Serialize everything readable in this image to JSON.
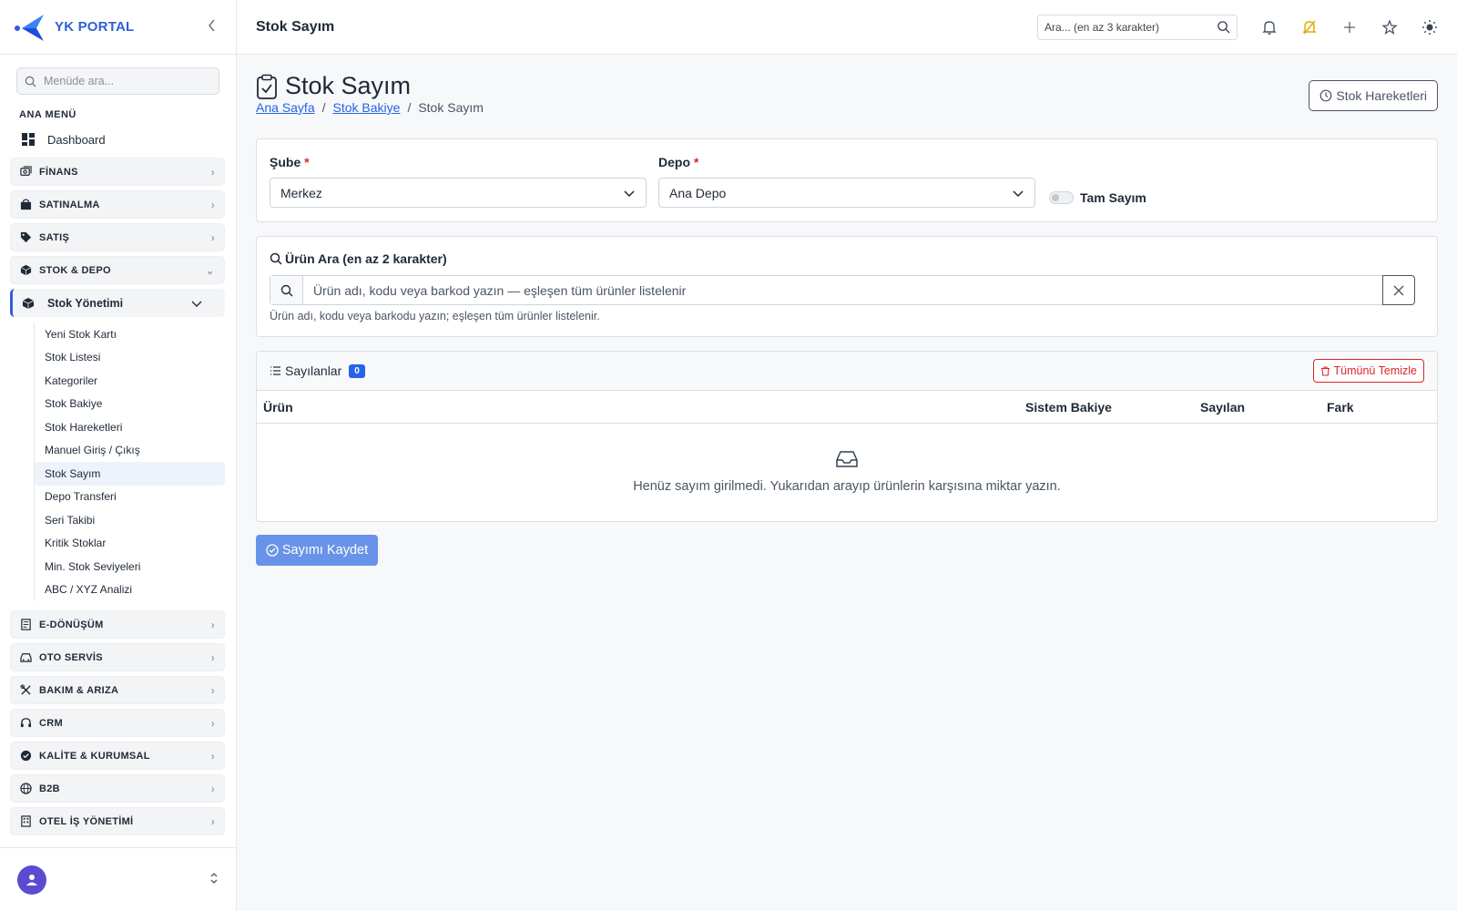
{
  "brand": {
    "name": "YK PORTAL"
  },
  "sidebar": {
    "search_placeholder": "Menüde ara...",
    "section_title": "ANA MENÜ",
    "dashboard_label": "Dashboard",
    "groups_top": [
      {
        "label": "FİNANS",
        "icon": "finance-icon"
      },
      {
        "label": "SATINALMA",
        "icon": "shopping-bag-icon"
      },
      {
        "label": "SATIŞ",
        "icon": "tag-icon"
      }
    ],
    "stock_group": {
      "label": "STOK & DEPO",
      "icon": "box-icon"
    },
    "stock_sub_head": "Stok Yönetimi",
    "stock_items": [
      "Yeni Stok Kartı",
      "Stok Listesi",
      "Kategoriler",
      "Stok Bakiye",
      "Stok Hareketleri",
      "Manuel Giriş / Çıkış",
      "Stok Sayım",
      "Depo Transferi",
      "Seri Takibi",
      "Kritik Stoklar",
      "Min. Stok Seviyeleri",
      "ABC / XYZ Analizi"
    ],
    "active_item": "Stok Sayım",
    "groups_bottom": [
      {
        "label": "E-DÖNÜŞÜM",
        "icon": "document-icon"
      },
      {
        "label": "OTO SERVİS",
        "icon": "car-icon"
      },
      {
        "label": "BAKIM & ARIZA",
        "icon": "tools-icon"
      },
      {
        "label": "CRM",
        "icon": "headset-icon"
      },
      {
        "label": "KALİTE & KURUMSAL",
        "icon": "quality-badge-icon"
      },
      {
        "label": "B2B",
        "icon": "globe-icon"
      },
      {
        "label": "OTEL İŞ YÖNETİMİ",
        "icon": "building-icon"
      }
    ]
  },
  "topbar": {
    "title": "Stok Sayım",
    "search_placeholder": "Ara... (en az 3 karakter)"
  },
  "page": {
    "title": "Stok Sayım",
    "breadcrumb": [
      "Ana Sayfa",
      "Stok Bakiye",
      "Stok Sayım"
    ],
    "history_button": "Stok Hareketleri"
  },
  "filters": {
    "branch_label": "Şube",
    "branch_value": "Merkez",
    "warehouse_label": "Depo",
    "warehouse_value": "Ana Depo",
    "required_mark": "*",
    "full_count_label": "Tam Sayım",
    "full_count_on": false
  },
  "product_search": {
    "label": "Ürün Ara (en az 2 karakter)",
    "placeholder": "Ürün adı, kodu veya barkod yazın — eşleşen tüm ürünler listelenir",
    "help": "Ürün adı, kodu veya barkodu yazın; eşleşen tüm ürünler listelenir."
  },
  "counted": {
    "title": "Sayılanlar",
    "count": "0",
    "clear_all": "Tümünü Temizle",
    "columns": [
      "Ürün",
      "Sistem Bakiye",
      "Sayılan",
      "Fark"
    ],
    "empty_text": "Henüz sayım girilmedi. Yukarıdan arayıp ürünlerin karşısına miktar yazın."
  },
  "save_button": "Sayımı Kaydet",
  "colors": {
    "accent": "#2f5fd6",
    "primary": "#2563eb",
    "danger": "#dc2626",
    "save": "#6993e8",
    "warning_bell": "#e0a800"
  }
}
